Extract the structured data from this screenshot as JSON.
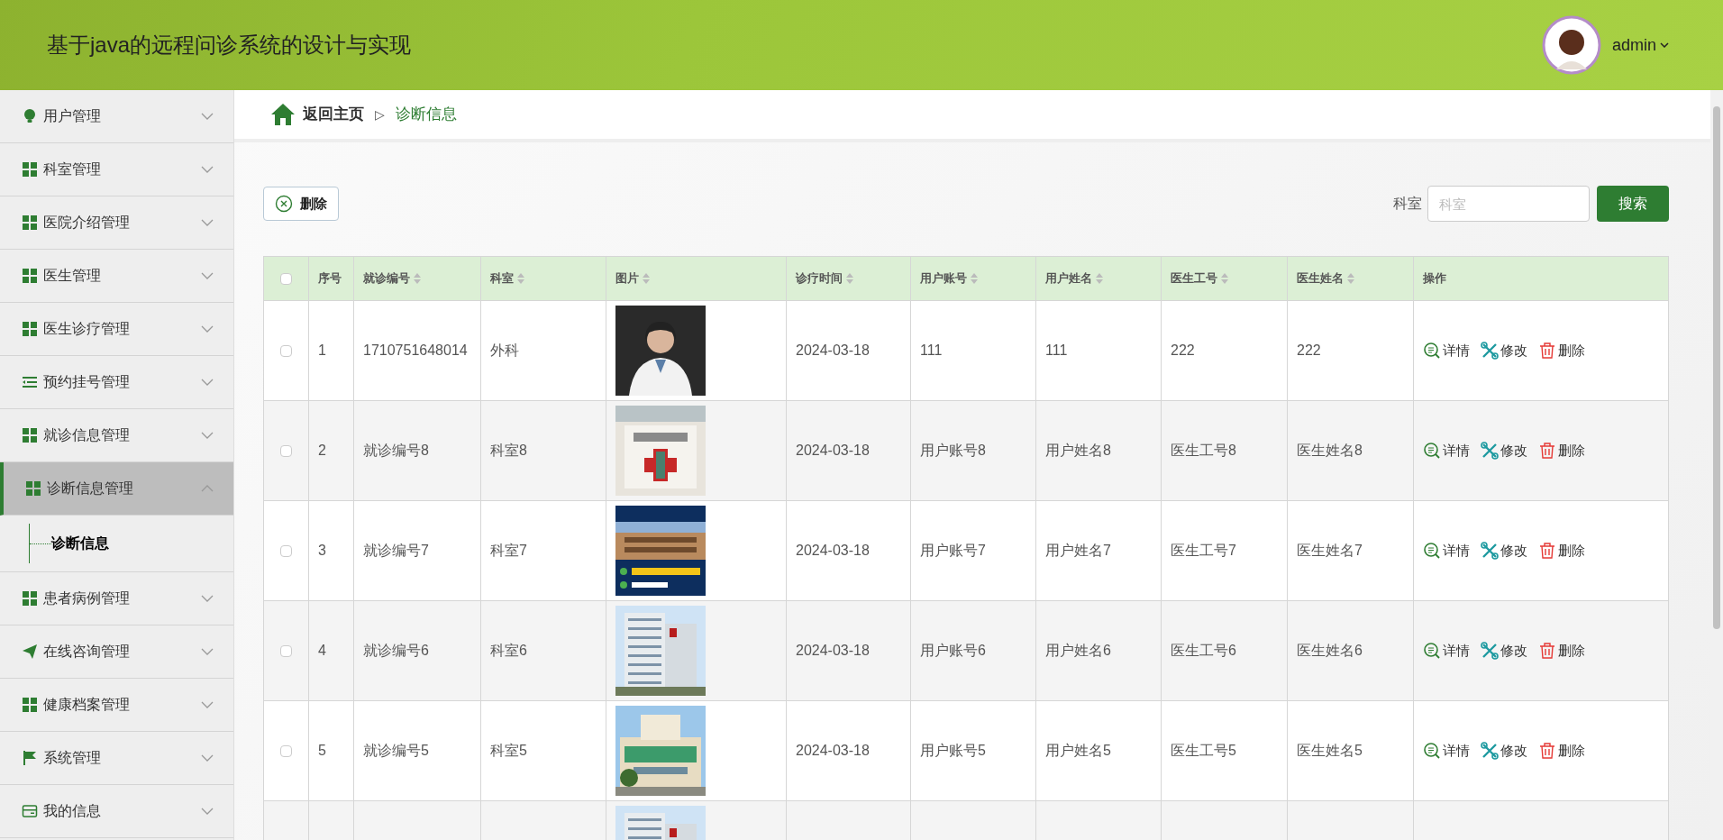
{
  "header": {
    "title": "基于java的远程问诊系统的设计与实现",
    "user": "admin"
  },
  "sidebar": {
    "items": [
      {
        "label": "用户管理",
        "kind": "bulb",
        "expanded": false
      },
      {
        "label": "科室管理",
        "kind": "grid",
        "expanded": false
      },
      {
        "label": "医院介绍管理",
        "kind": "grid",
        "expanded": false
      },
      {
        "label": "医生管理",
        "kind": "grid",
        "expanded": false
      },
      {
        "label": "医生诊疗管理",
        "kind": "grid",
        "expanded": false
      },
      {
        "label": "预约挂号管理",
        "kind": "list",
        "expanded": false
      },
      {
        "label": "就诊信息管理",
        "kind": "grid",
        "expanded": false
      },
      {
        "label": "诊断信息管理",
        "kind": "grid",
        "expanded": true,
        "children": [
          {
            "label": "诊断信息",
            "selected": true
          }
        ]
      },
      {
        "label": "患者病例管理",
        "kind": "grid",
        "expanded": false
      },
      {
        "label": "在线咨询管理",
        "kind": "plane",
        "expanded": false
      },
      {
        "label": "健康档案管理",
        "kind": "grid",
        "expanded": false
      },
      {
        "label": "系统管理",
        "kind": "flag",
        "expanded": false
      },
      {
        "label": "我的信息",
        "kind": "card",
        "expanded": false
      }
    ]
  },
  "breadcrumb": {
    "home": "返回主页",
    "separator": "▷",
    "current": "诊断信息"
  },
  "toolbar": {
    "delete": "删除",
    "search_label": "科室",
    "search_placeholder": "科室",
    "search_button": "搜索"
  },
  "table": {
    "all_checked": false,
    "columns": [
      {
        "label": "序号",
        "sortable": false
      },
      {
        "label": "就诊编号",
        "sortable": true
      },
      {
        "label": "科室",
        "sortable": true
      },
      {
        "label": "图片",
        "sortable": true
      },
      {
        "label": "诊疗时间",
        "sortable": true
      },
      {
        "label": "用户账号",
        "sortable": true
      },
      {
        "label": "用户姓名",
        "sortable": true
      },
      {
        "label": "医生工号",
        "sortable": true
      },
      {
        "label": "医生姓名",
        "sortable": true
      },
      {
        "label": "操作",
        "sortable": false
      }
    ],
    "rows": [
      {
        "checked": false,
        "cells": [
          "1",
          "1710751648014",
          "外科",
          {
            "kind": "picture"
          },
          "2024-03-18",
          "111",
          "111",
          "222",
          "222"
        ],
        "actions": [
          "详情",
          "修改",
          "删除"
        ]
      },
      {
        "checked": false,
        "cells": [
          "2",
          "就诊编号8",
          "科室8",
          {
            "kind": "picture"
          },
          "2024-03-18",
          "用户账号8",
          "用户姓名8",
          "医生工号8",
          "医生姓名8"
        ],
        "actions": [
          "详情",
          "修改",
          "删除"
        ]
      },
      {
        "checked": false,
        "cells": [
          "3",
          "就诊编号7",
          "科室7",
          {
            "kind": "picture"
          },
          "2024-03-18",
          "用户账号7",
          "用户姓名7",
          "医生工号7",
          "医生姓名7"
        ],
        "actions": [
          "详情",
          "修改",
          "删除"
        ]
      },
      {
        "checked": false,
        "cells": [
          "4",
          "就诊编号6",
          "科室6",
          {
            "kind": "picture"
          },
          "2024-03-18",
          "用户账号6",
          "用户姓名6",
          "医生工号6",
          "医生姓名6"
        ],
        "actions": [
          "详情",
          "修改",
          "删除"
        ]
      },
      {
        "checked": false,
        "cells": [
          "5",
          "就诊编号5",
          "科室5",
          {
            "kind": "picture"
          },
          "2024-03-18",
          "用户账号5",
          "用户姓名5",
          "医生工号5",
          "医生姓名5"
        ],
        "actions": [
          "详情",
          "修改",
          "删除"
        ]
      },
      {
        "cells": [
          "",
          "",
          "",
          {
            "kind": "picture"
          }
        ]
      }
    ]
  }
}
